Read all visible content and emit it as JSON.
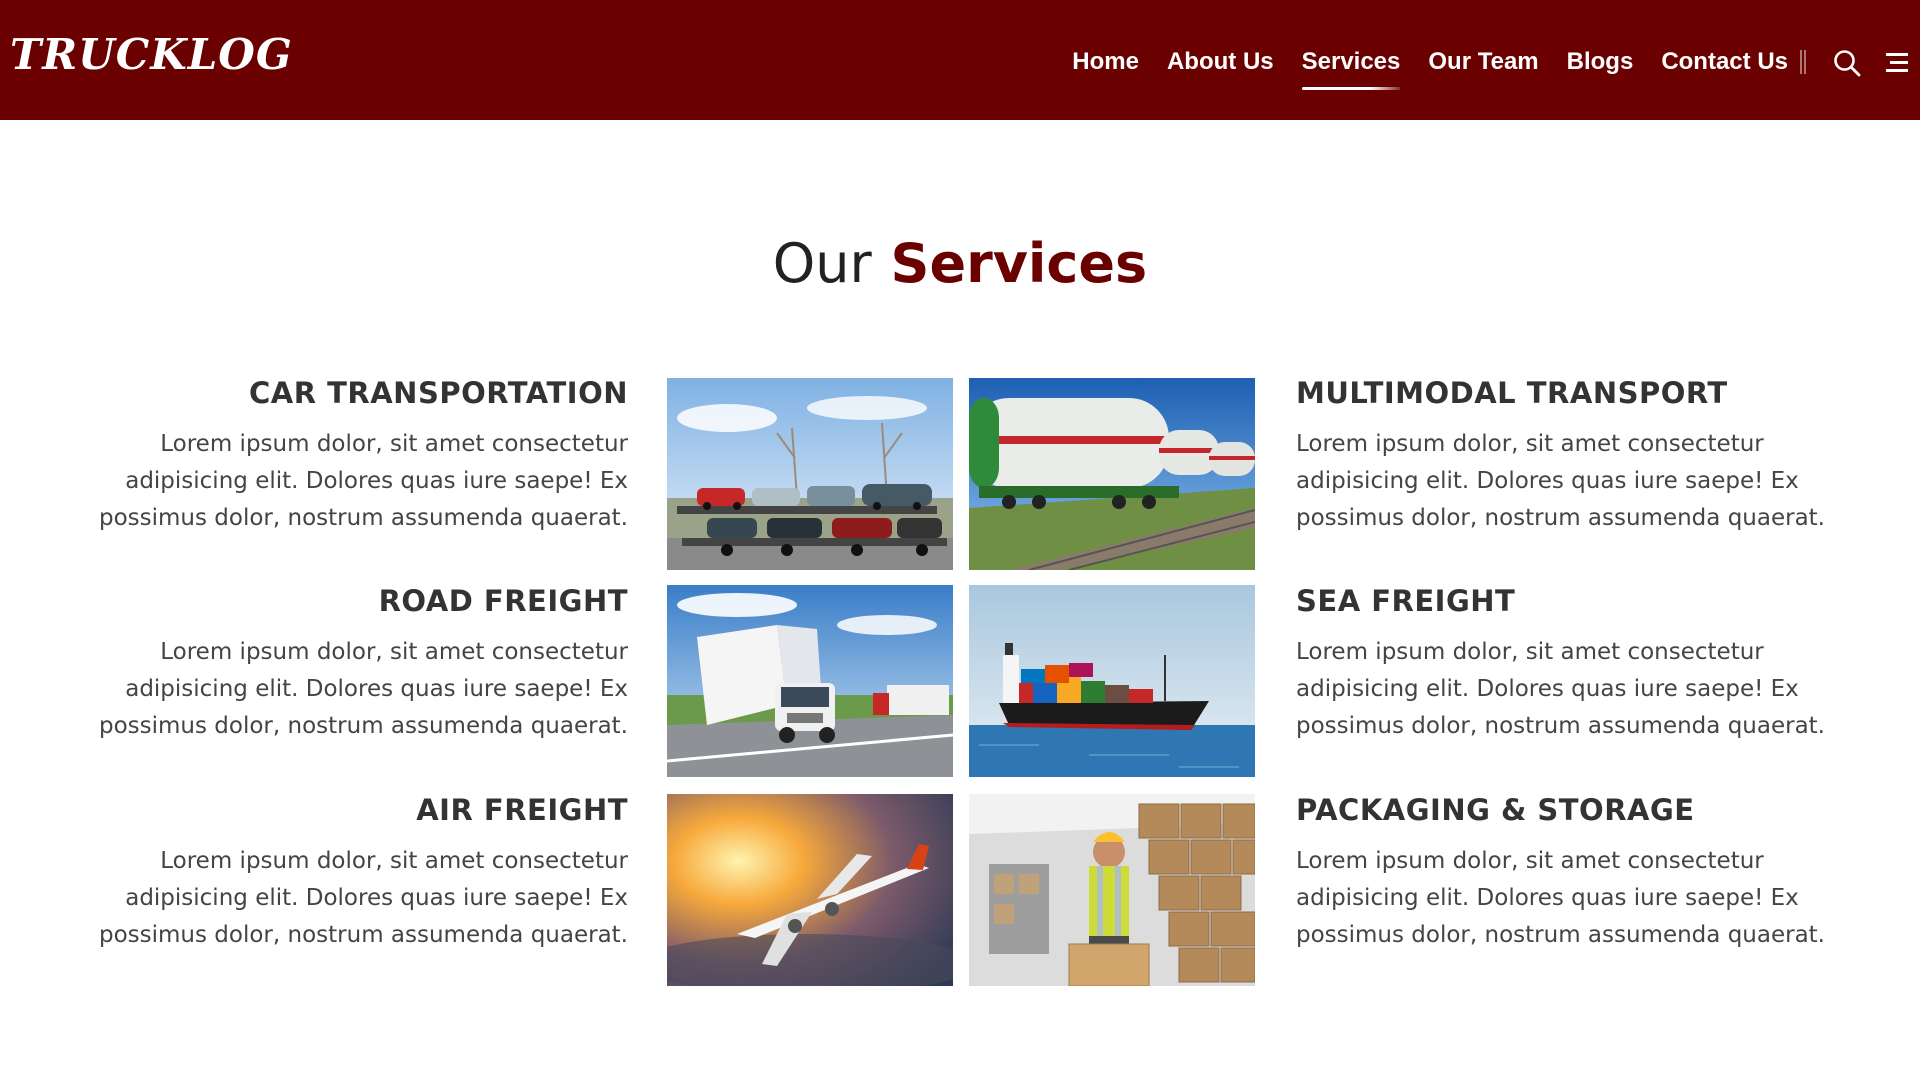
{
  "brand": {
    "logo_text": "TRUCKLOG"
  },
  "nav": {
    "items": [
      {
        "label": "Home"
      },
      {
        "label": "About Us"
      },
      {
        "label": "Services"
      },
      {
        "label": "Our Team"
      },
      {
        "label": "Blogs"
      },
      {
        "label": "Contact Us"
      }
    ],
    "active": "Services",
    "icons": [
      "search-icon",
      "menu-icon"
    ]
  },
  "section": {
    "title_plain": "Our",
    "title_accent": "Services"
  },
  "services": [
    {
      "title": "CAR TRANSPORTATION",
      "text": "Lorem ipsum dolor, sit amet consectetur adipisicing elit. Dolores quas iure saepe! Ex possimus dolor, nostrum assumenda quaerat."
    },
    {
      "title": "MULTIMODAL TRANSPORT",
      "text": "Lorem ipsum dolor, sit amet consectetur adipisicing elit. Dolores quas iure saepe! Ex possimus dolor, nostrum assumenda quaerat."
    },
    {
      "title": "ROAD FREIGHT",
      "text": "Lorem ipsum dolor, sit amet consectetur adipisicing elit. Dolores quas iure saepe! Ex possimus dolor, nostrum assumenda quaerat."
    },
    {
      "title": "SEA FREIGHT",
      "text": "Lorem ipsum dolor, sit amet consectetur adipisicing elit. Dolores quas iure saepe! Ex possimus dolor, nostrum assumenda quaerat."
    },
    {
      "title": "AIR FREIGHT",
      "text": "Lorem ipsum dolor, sit amet consectetur adipisicing elit. Dolores quas iure saepe! Ex possimus dolor, nostrum assumenda quaerat."
    },
    {
      "title": "PACKAGING & STORAGE",
      "text": "Lorem ipsum dolor, sit amet consectetur adipisicing elit. Dolores quas iure saepe! Ex possimus dolor, nostrum assumenda quaerat."
    }
  ],
  "colors": {
    "brand": "#6b0000",
    "text": "#333333",
    "nav_text": "#ffffff"
  }
}
